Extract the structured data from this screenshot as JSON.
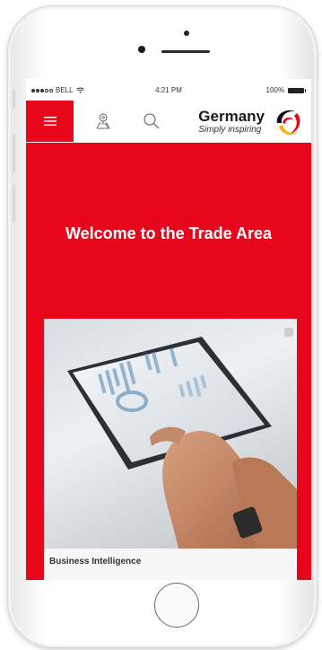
{
  "status_bar": {
    "carrier": "BELL",
    "time": "4:21 PM",
    "battery": "100%"
  },
  "nav": {
    "icons": [
      "menu-icon",
      "map-pin-icon",
      "search-icon"
    ],
    "logo_title": "Germany",
    "logo_subtitle": "Simply inspiring"
  },
  "hero": {
    "title": "Welcome to the Trade Area"
  },
  "card": {
    "caption": "Business Intelligence",
    "image": "tablet-analytics-photo"
  },
  "colors": {
    "accent": "#e8061c",
    "background": "#ffffff"
  }
}
